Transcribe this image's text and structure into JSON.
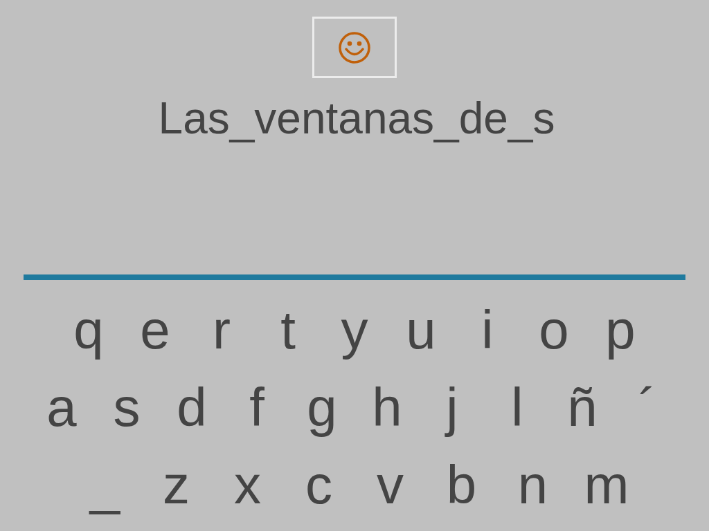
{
  "feedback": {
    "kind": "happy"
  },
  "phrase": "Las_ventanas_de_s",
  "keyboard": [
    [
      "q",
      "e",
      "r",
      "t",
      "y",
      "u",
      "i",
      "o",
      "p"
    ],
    [
      "a",
      "s",
      "d",
      "f",
      "g",
      "h",
      "j",
      "l",
      "ñ",
      "´"
    ],
    [
      "_",
      "z",
      "x",
      "c",
      "v",
      "b",
      "n",
      "m"
    ]
  ]
}
